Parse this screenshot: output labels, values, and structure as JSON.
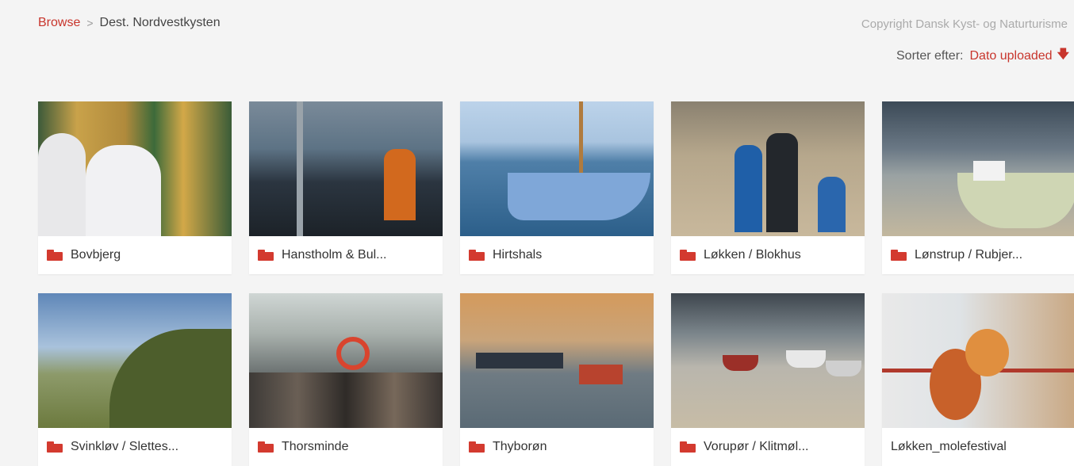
{
  "breadcrumb": {
    "root": "Browse",
    "separator": ">",
    "current": "Dest. Nordvestkysten"
  },
  "copyright": "Copyright Dansk Kyst- og Naturturisme",
  "sort": {
    "label": "Sorter efter:",
    "value": "Dato uploaded",
    "direction_icon": "arrow-down-icon"
  },
  "accent_color": "#c8352c",
  "items": [
    {
      "title": "Bovbjerg",
      "type": "folder"
    },
    {
      "title": "Hanstholm & Bul...",
      "type": "folder"
    },
    {
      "title": "Hirtshals",
      "type": "folder"
    },
    {
      "title": "Løkken / Blokhus",
      "type": "folder"
    },
    {
      "title": "Lønstrup / Rubjer...",
      "type": "folder"
    },
    {
      "title": "Svinkløv / Slettes...",
      "type": "folder"
    },
    {
      "title": "Thorsminde",
      "type": "folder"
    },
    {
      "title": "Thyborøn",
      "type": "folder"
    },
    {
      "title": "Vorupør / Klitmøl...",
      "type": "folder"
    },
    {
      "title": "Løkken_molefestival",
      "type": "file"
    }
  ]
}
